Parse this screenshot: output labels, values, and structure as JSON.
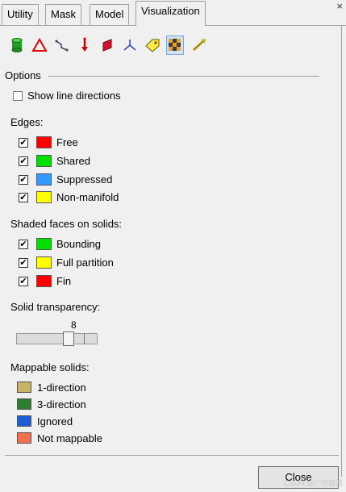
{
  "tabs": [
    {
      "label": "Utility",
      "active": false
    },
    {
      "label": "Mask",
      "active": false
    },
    {
      "label": "Model",
      "active": false
    },
    {
      "label": "Visualization",
      "active": true
    }
  ],
  "close_x": "×",
  "toolbar": [
    {
      "icon": "cylinder-solid-icon"
    },
    {
      "icon": "triangle-outline-icon"
    },
    {
      "icon": "line-segments-icon"
    },
    {
      "icon": "vector-arrow-icon"
    },
    {
      "icon": "surface-patch-icon"
    },
    {
      "icon": "axes-system-icon"
    },
    {
      "icon": "tag-label-icon"
    },
    {
      "icon": "checker-pattern-icon",
      "pressed": true
    },
    {
      "icon": "pencil-arrow-icon"
    }
  ],
  "options": {
    "group_label": "Options",
    "show_line_directions": {
      "label": "Show line directions",
      "checked": false
    },
    "edges": {
      "label": "Edges:",
      "items": [
        {
          "label": "Free",
          "checked": true,
          "color": "#ff0000"
        },
        {
          "label": "Shared",
          "checked": true,
          "color": "#00e000"
        },
        {
          "label": "Suppressed",
          "checked": true,
          "color": "#3399ff"
        },
        {
          "label": "Non-manifold",
          "checked": true,
          "color": "#ffff00"
        }
      ]
    },
    "shaded_faces": {
      "label": "Shaded faces on solids:",
      "items": [
        {
          "label": "Bounding",
          "checked": true,
          "color": "#00e000"
        },
        {
          "label": "Full partition",
          "checked": true,
          "color": "#ffff00"
        },
        {
          "label": "Fin",
          "checked": true,
          "color": "#ff0000"
        }
      ]
    },
    "transparency": {
      "label": "Solid transparency:",
      "value": "8",
      "max": 10
    },
    "mappable": {
      "label": "Mappable solids:",
      "items": [
        {
          "label": "1-direction",
          "color": "#c8b266"
        },
        {
          "label": "3-direction",
          "color": "#2e7d32"
        },
        {
          "label": "Ignored",
          "color": "#1e5fd6"
        },
        {
          "label": "Not mappable",
          "color": "#f07050"
        }
      ]
    }
  },
  "close_button": "Close",
  "watermark": "CSDN @广州智造"
}
